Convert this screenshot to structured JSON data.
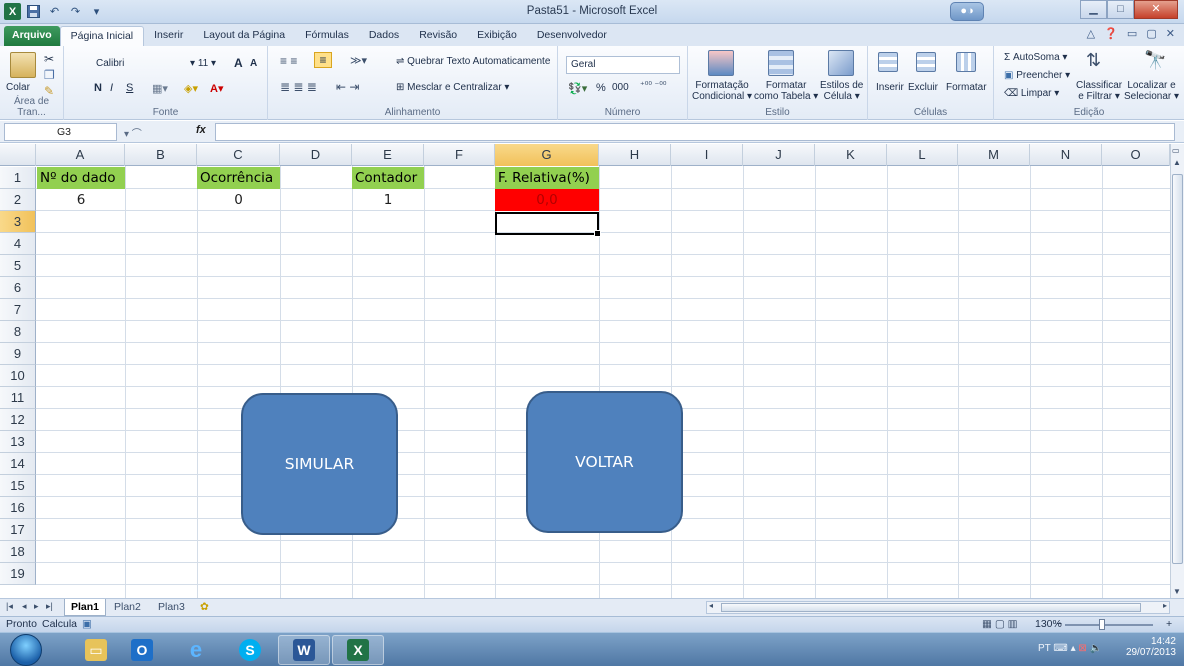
{
  "window": {
    "title": "Pasta51 - Microsoft Excel",
    "controls": {
      "minimize": "▁",
      "maximize": "□",
      "close": "✕"
    }
  },
  "quick_access": {
    "save_icon": "save-icon",
    "undo": "↶",
    "redo": "↷",
    "more": "▾"
  },
  "tabs": [
    {
      "label": "Arquivo"
    },
    {
      "label": "Página Inicial"
    },
    {
      "label": "Inserir"
    },
    {
      "label": "Layout da Página"
    },
    {
      "label": "Fórmulas"
    },
    {
      "label": "Dados"
    },
    {
      "label": "Revisão"
    },
    {
      "label": "Exibição"
    },
    {
      "label": "Desenvolvedor"
    }
  ],
  "ribbon": {
    "clipboard": {
      "paste": "Colar",
      "label": "Área de Tran..."
    },
    "font": {
      "name": "Calibri",
      "size": "11",
      "bold": "N",
      "italic": "I",
      "underline": "S",
      "grow": "A",
      "shrink": "A",
      "label": "Fonte"
    },
    "alignment": {
      "wrap": "Quebrar Texto Automaticamente",
      "merge": "Mesclar e Centralizar",
      "label": "Alinhamento"
    },
    "number": {
      "format": "Geral",
      "percent": "%",
      "thousands": "000",
      "label": "Número"
    },
    "styles": {
      "conditional_1": "Formatação",
      "conditional_2": "Condicional",
      "table_1": "Formatar",
      "table_2": "como Tabela",
      "cell_1": "Estilos de",
      "cell_2": "Célula",
      "label": "Estilo"
    },
    "cells": {
      "insert": "Inserir",
      "delete": "Excluir",
      "format": "Formatar",
      "label": "Células"
    },
    "editing": {
      "autosum": "Σ AutoSoma",
      "fill": "Preencher",
      "clear": "Limpar",
      "sort_1": "Classificar",
      "sort_2": "e Filtrar",
      "find_1": "Localizar e",
      "find_2": "Selecionar",
      "label": "Edição"
    }
  },
  "formula_bar": {
    "name_box": "G3",
    "fx": "fx",
    "value": ""
  },
  "columns": [
    "A",
    "B",
    "C",
    "D",
    "E",
    "F",
    "G",
    "H",
    "I",
    "J",
    "K",
    "L",
    "M",
    "N",
    "O"
  ],
  "rows": [
    "1",
    "2",
    "3",
    "4",
    "5",
    "6",
    "7",
    "8",
    "9",
    "10",
    "11",
    "12",
    "13",
    "14",
    "15",
    "16",
    "17",
    "18",
    "19"
  ],
  "cells": {
    "A1": "Nº do dado",
    "C1": "Ocorrência",
    "E1": "Contador",
    "G1": "F. Relativa(%)",
    "A2": "6",
    "C2": "0",
    "E2": "1",
    "G2": "0,0"
  },
  "colors": {
    "header_fill": "#92d050",
    "alert_fill": "#ff0000",
    "alert_text": "#b30000",
    "shape_fill": "#4f81bd",
    "shape_border": "#385d8a"
  },
  "shapes": {
    "simulate": "SIMULAR",
    "back": "VOLTAR"
  },
  "sheets": [
    {
      "label": "Plan1"
    },
    {
      "label": "Plan2"
    },
    {
      "label": "Plan3"
    }
  ],
  "status": {
    "ready": "Pronto",
    "calc": "Calcula",
    "zoom": "130%",
    "minus": "−",
    "plus": "+"
  },
  "taskbar": {
    "apps": [
      "explorer-icon",
      "outlook-icon",
      "ie-icon",
      "skype-icon",
      "word-icon",
      "excel-icon"
    ],
    "lang": "PT",
    "time": "14:42",
    "date": "29/07/2013"
  }
}
